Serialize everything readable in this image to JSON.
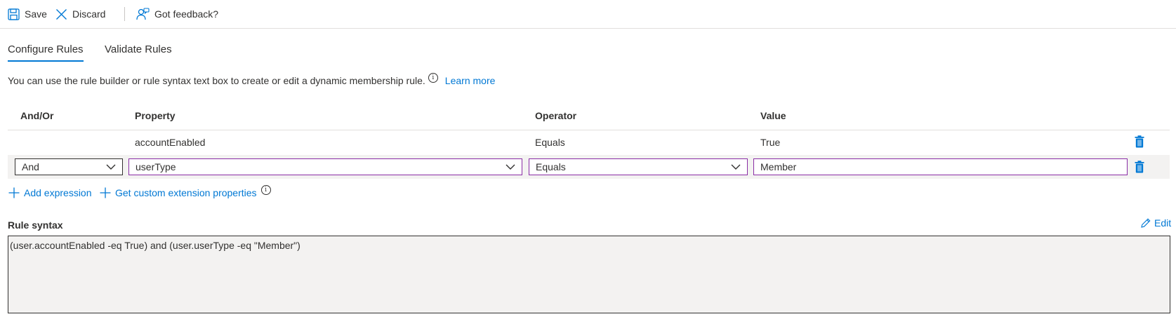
{
  "toolbar": {
    "save_label": "Save",
    "discard_label": "Discard",
    "feedback_label": "Got feedback?"
  },
  "tabs": [
    {
      "label": "Configure Rules",
      "active": true
    },
    {
      "label": "Validate Rules",
      "active": false
    }
  ],
  "intro": {
    "text": "You can use the rule builder or rule syntax text box to create or edit a dynamic membership rule.",
    "info_icon": "i",
    "learn_more": "Learn more"
  },
  "table": {
    "headers": [
      "And/Or",
      "Property",
      "Operator",
      "Value"
    ],
    "rows": [
      {
        "andor": "",
        "property": "accountEnabled",
        "operator": "Equals",
        "value": "True"
      },
      {
        "andor": "And",
        "property": "userType",
        "operator": "Equals",
        "value": "Member"
      }
    ]
  },
  "actions": {
    "add_expression": "Add expression",
    "custom_ext": "Get custom extension properties",
    "info_icon": "i"
  },
  "rule_syntax": {
    "label": "Rule syntax",
    "edit_label": "Edit",
    "value": "(user.accountEnabled -eq True) and (user.userType -eq \"Member\")"
  },
  "colors": {
    "accent": "#0078d4",
    "focus_border": "#8a2da5",
    "text": "#323130",
    "row_highlight": "#f3f2f1"
  },
  "icons": [
    "save-icon",
    "close-icon",
    "feedback-icon",
    "info-icon",
    "chevron-down-icon",
    "trash-icon",
    "plus-icon",
    "pencil-icon"
  ]
}
